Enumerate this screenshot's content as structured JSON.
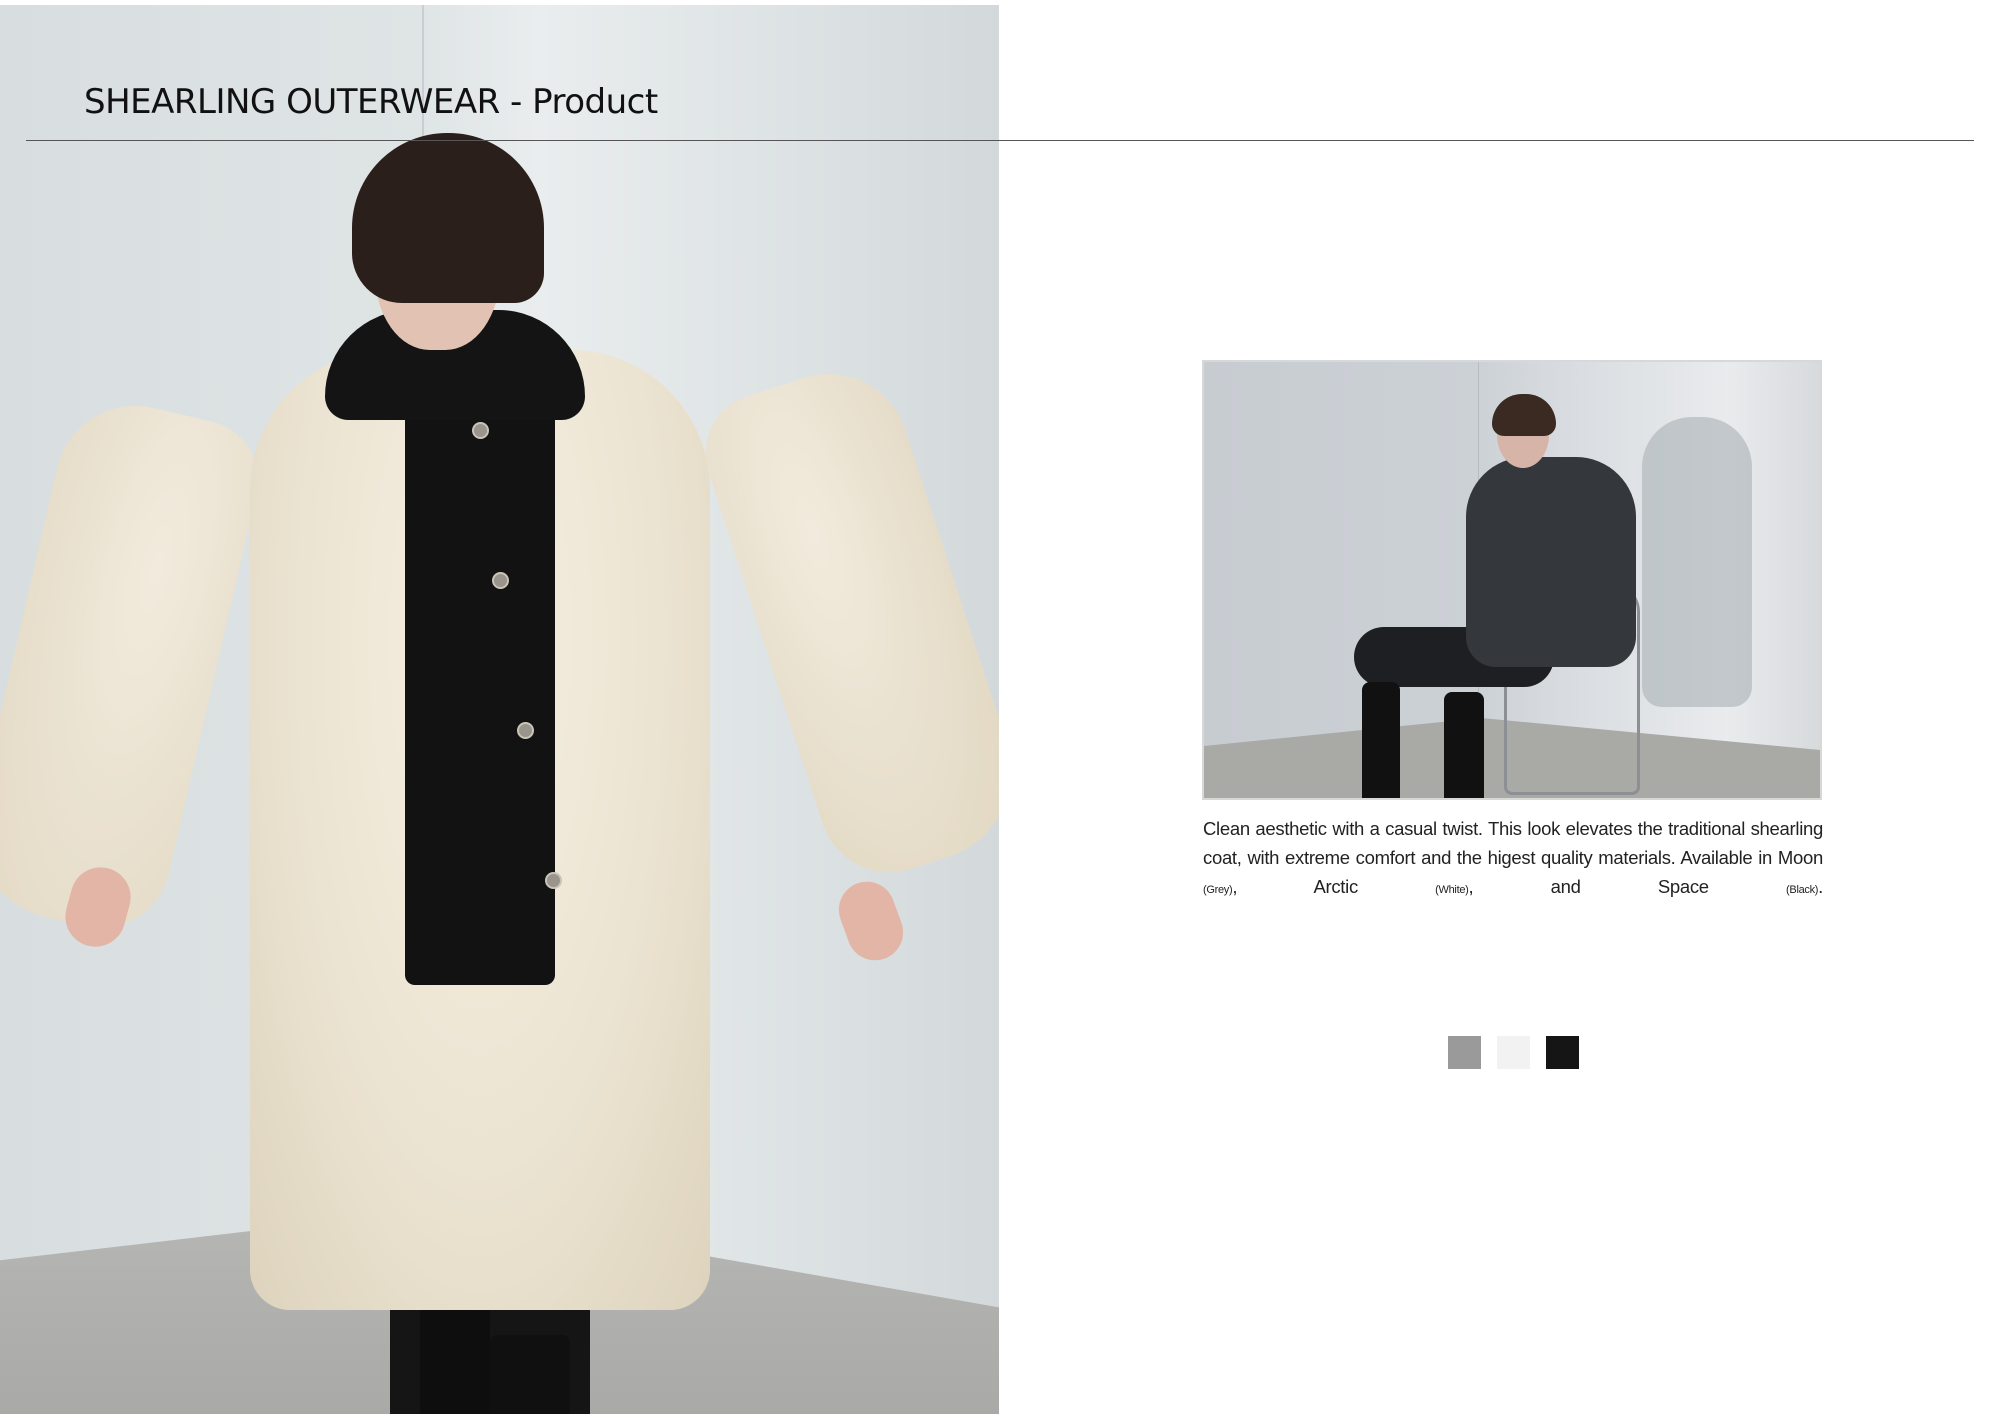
{
  "header": {
    "title": "SHEARLING OUTERWEAR - Product"
  },
  "hero_image": {
    "description_icon": "model-white-shearling-coat-photo"
  },
  "product_image": {
    "description_icon": "model-seated-grey-shearling-coat-photo"
  },
  "caption": {
    "text_before": "Clean aesthetic with a casual twist. This look elevates the traditional shearling coat, with extreme comfort and the higest quality materials. Available in",
    "colors": [
      {
        "name": "Moon",
        "note": "(Grey)"
      },
      {
        "name": "Arctic",
        "note": "(White)"
      },
      {
        "name": "Space",
        "note": "(Black)"
      }
    ],
    "sep1": ",",
    "sep2": ", and",
    "end": "."
  },
  "swatches": [
    {
      "label": "Moon",
      "color": "#9a9a9a"
    },
    {
      "label": "Arctic",
      "color": "#f1f2f1"
    },
    {
      "label": "Space",
      "color": "#151515"
    }
  ],
  "colors": {
    "rule": "#555555",
    "text": "#1a1a1a"
  }
}
